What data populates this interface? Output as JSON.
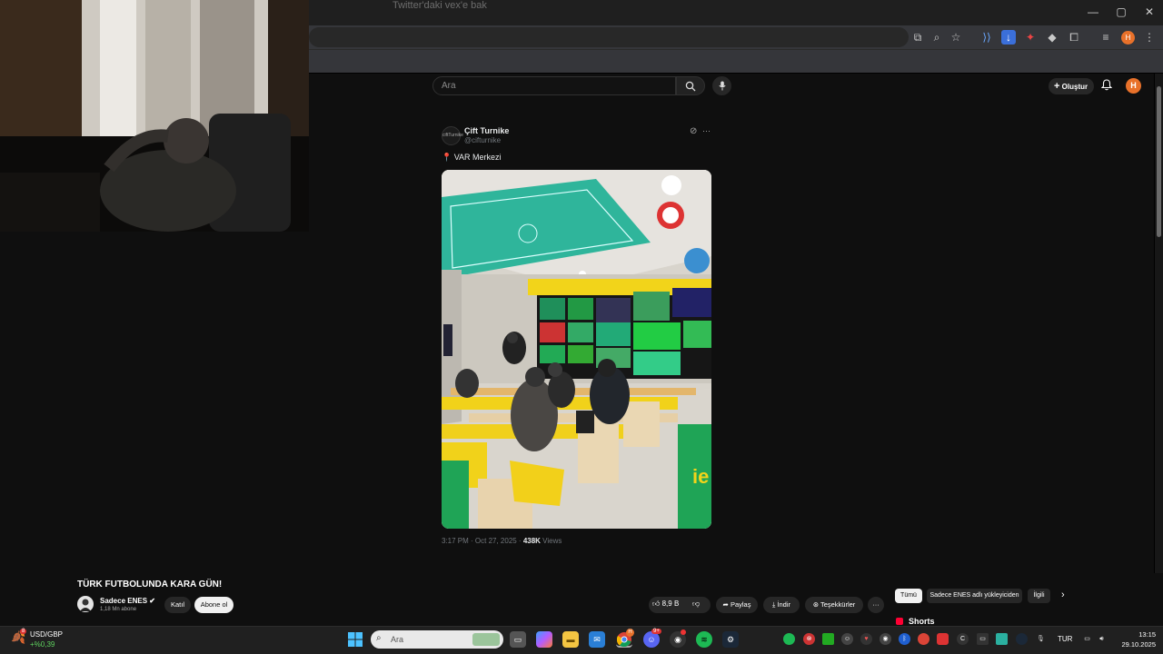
{
  "browser": {
    "tab_hint": "Twitter'daki vex'e bak",
    "window_buttons": [
      "—",
      "▢",
      "✕"
    ]
  },
  "youtube": {
    "search_placeholder": "Ara",
    "create_label": "Oluştur",
    "avatar_letter": "H"
  },
  "tweet": {
    "avatar_text": "ciftTurnike",
    "name": "Çift Turnike",
    "handle": "@cifturnike",
    "more": "···",
    "text": "📍 VAR Merkezi",
    "time": "3:17 PM · Oct 27, 2025 · ",
    "views_count": "438K",
    "views_label": " Views"
  },
  "video": {
    "title": "TÜRK FUTBOLUNDA KARA GÜN!",
    "channel_name": "Sadece ENES ✔",
    "subscribers": "1,18 Mn abone",
    "join_label": "Katıl",
    "subscribe_label": "Abone ol",
    "like_count": "8,9 B",
    "share_label": "Paylaş",
    "download_label": "İndir",
    "thanks_label": "Teşekkürler",
    "more_label": "···",
    "chips": [
      "Tümü",
      "Sadece ENES adlı yükleyiciden",
      "İlgili"
    ],
    "shorts_label": "Shorts"
  },
  "taskbar": {
    "ticker_name": "USD/GBP",
    "ticker_change": "+%0,39",
    "ticker_badge": "8",
    "search_placeholder": "Ara",
    "language": "TUR",
    "time": "13:15",
    "date": "29.10.2025",
    "badge_h": "H",
    "badge_discord": "9+"
  }
}
